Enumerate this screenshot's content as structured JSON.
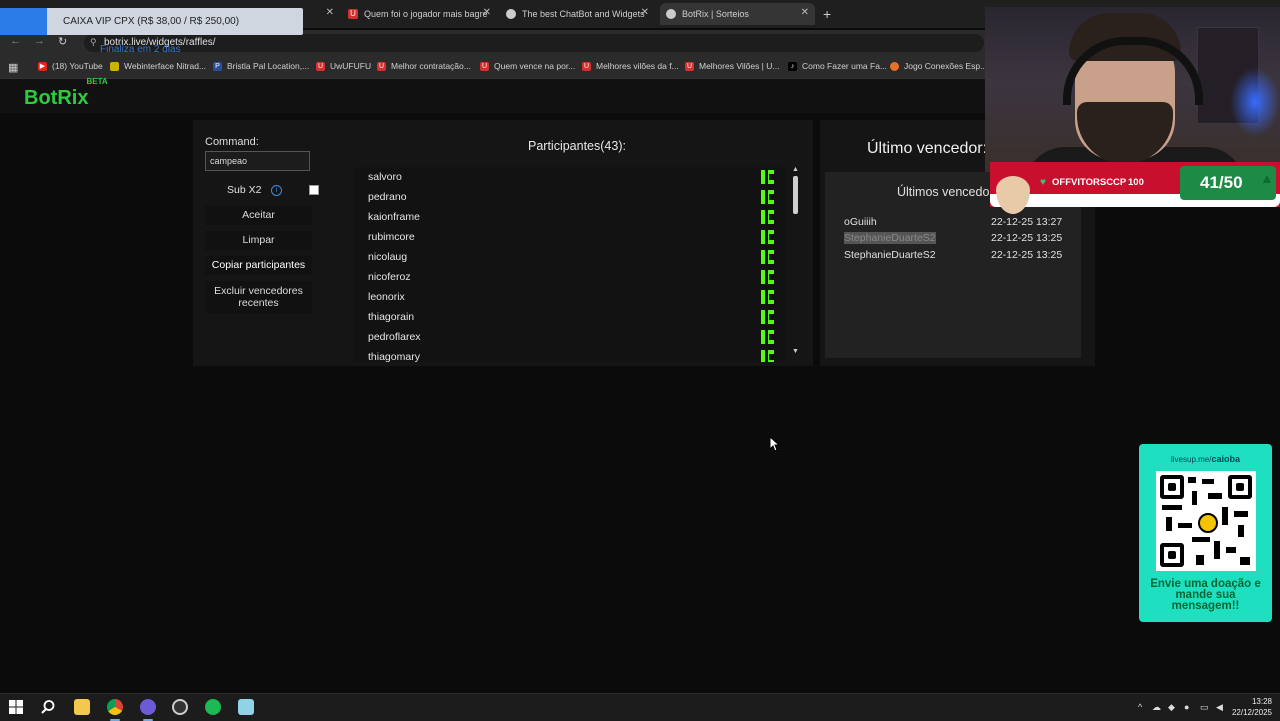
{
  "browser": {
    "tabs": [
      {
        "title": "",
        "x": 0
      },
      {
        "title": "Quem foi o jogador mais bagre",
        "x": 0
      },
      {
        "title": "The best ChatBot and Widgets",
        "x": 0
      },
      {
        "title": "BotRix | Sorteios",
        "x": 0
      }
    ],
    "url": "botrix.live/widgets/raffles/",
    "bookmarks": [
      "(18) YouTube",
      "Webinterface Nitrad...",
      "Bristla Pal Location,...",
      "UwUFUFU",
      "Melhor contratação...",
      "Quem vence na por...",
      "Melhores vilões da f...",
      "Melhores Vilões | U...",
      "Como Fazer uma Fa...",
      "Jogo Conexões Esp..."
    ]
  },
  "notification": {
    "title": "CAIXA VIP CPX (R$ 38,00 / R$ 250,00)",
    "subtitle": "Finaliza em 2 dias"
  },
  "app": {
    "logo": "BotRix",
    "logo_badge": "BETA"
  },
  "raffle": {
    "command_label": "Command:",
    "command_value": "campeao",
    "sub_label": "Sub X2",
    "buttons": {
      "accept": "Aceitar",
      "clear": "Limpar",
      "copy": "Copiar participantes",
      "exclude": "Excluir vencedores recentes"
    },
    "participants_title": "Participantes(43):",
    "participants": [
      "salvoro",
      "pedrano",
      "kaionframe",
      "rubimcore",
      "nicolaug",
      "nicoferoz",
      "leonorix",
      "thiagorain",
      "pedroflarex",
      "thiagomary"
    ],
    "last_winner_title": "Último vencedor:",
    "winners_title": "Últimos vencedo",
    "winners": [
      {
        "name": "oGuiiih",
        "date": "22-12-25 13:27"
      },
      {
        "name": "StephanieDuarteS2",
        "date": "22-12-25 13:25"
      },
      {
        "name": "StephanieDuarteS2",
        "date": "22-12-25 13:25"
      }
    ]
  },
  "overlay": {
    "sub_goal_user": "OFFVITORSCCP",
    "sub_goal_amount": "100",
    "sub_goal_progress": "41/50",
    "donation_url_prefix": "livesup.me/",
    "donation_url_user": "caioba",
    "donation_text": "Envie uma doação e mande sua mensagem!!"
  },
  "taskbar": {
    "time": "13:28",
    "date": "22/12/2025"
  }
}
